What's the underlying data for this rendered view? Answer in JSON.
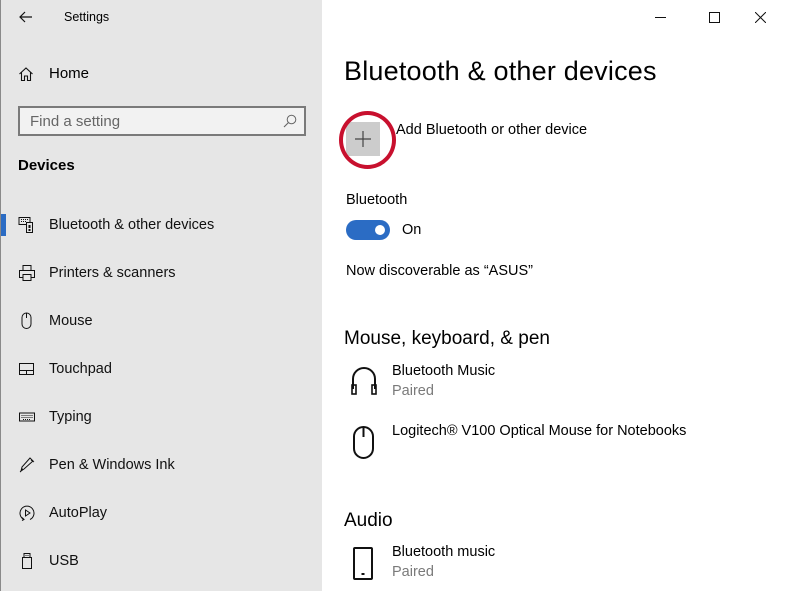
{
  "window": {
    "app_title": "Settings",
    "controls": {
      "minimize": "minimize-icon",
      "maximize": "maximize-icon",
      "close": "close-icon"
    }
  },
  "sidebar": {
    "back_icon": "back-arrow-icon",
    "home": {
      "label": "Home",
      "icon": "home-icon"
    },
    "search": {
      "placeholder": "Find a setting",
      "value": "",
      "icon": "search-icon"
    },
    "section_title": "Devices",
    "items": [
      {
        "label": "Bluetooth & other devices",
        "icon": "bluetooth-devices-icon",
        "selected": true
      },
      {
        "label": "Printers & scanners",
        "icon": "printer-icon",
        "selected": false
      },
      {
        "label": "Mouse",
        "icon": "mouse-icon",
        "selected": false
      },
      {
        "label": "Touchpad",
        "icon": "touchpad-icon",
        "selected": false
      },
      {
        "label": "Typing",
        "icon": "keyboard-icon",
        "selected": false
      },
      {
        "label": "Pen & Windows Ink",
        "icon": "pen-icon",
        "selected": false
      },
      {
        "label": "AutoPlay",
        "icon": "autoplay-icon",
        "selected": false
      },
      {
        "label": "USB",
        "icon": "usb-icon",
        "selected": false
      }
    ],
    "accent_color": "#2b6cc4"
  },
  "main": {
    "page_title": "Bluetooth & other devices",
    "add_device": {
      "label": "Add Bluetooth or other device",
      "icon": "plus-icon",
      "highlight_color": "#c8102e"
    },
    "bluetooth": {
      "label": "Bluetooth",
      "toggle_on": true,
      "state_label": "On",
      "toggle_color": "#2b6cc4"
    },
    "discoverable_text": "Now discoverable as “ASUS”",
    "groups": [
      {
        "title": "Mouse, keyboard, & pen",
        "devices": [
          {
            "name": "Bluetooth Music",
            "status": "Paired",
            "icon": "headphones-icon"
          },
          {
            "name": "Logitech® V100 Optical Mouse for Notebooks",
            "status": "",
            "icon": "mouse-icon"
          }
        ]
      },
      {
        "title": "Audio",
        "devices": [
          {
            "name": "Bluetooth music",
            "status": "Paired",
            "icon": "phone-icon"
          }
        ]
      }
    ]
  }
}
